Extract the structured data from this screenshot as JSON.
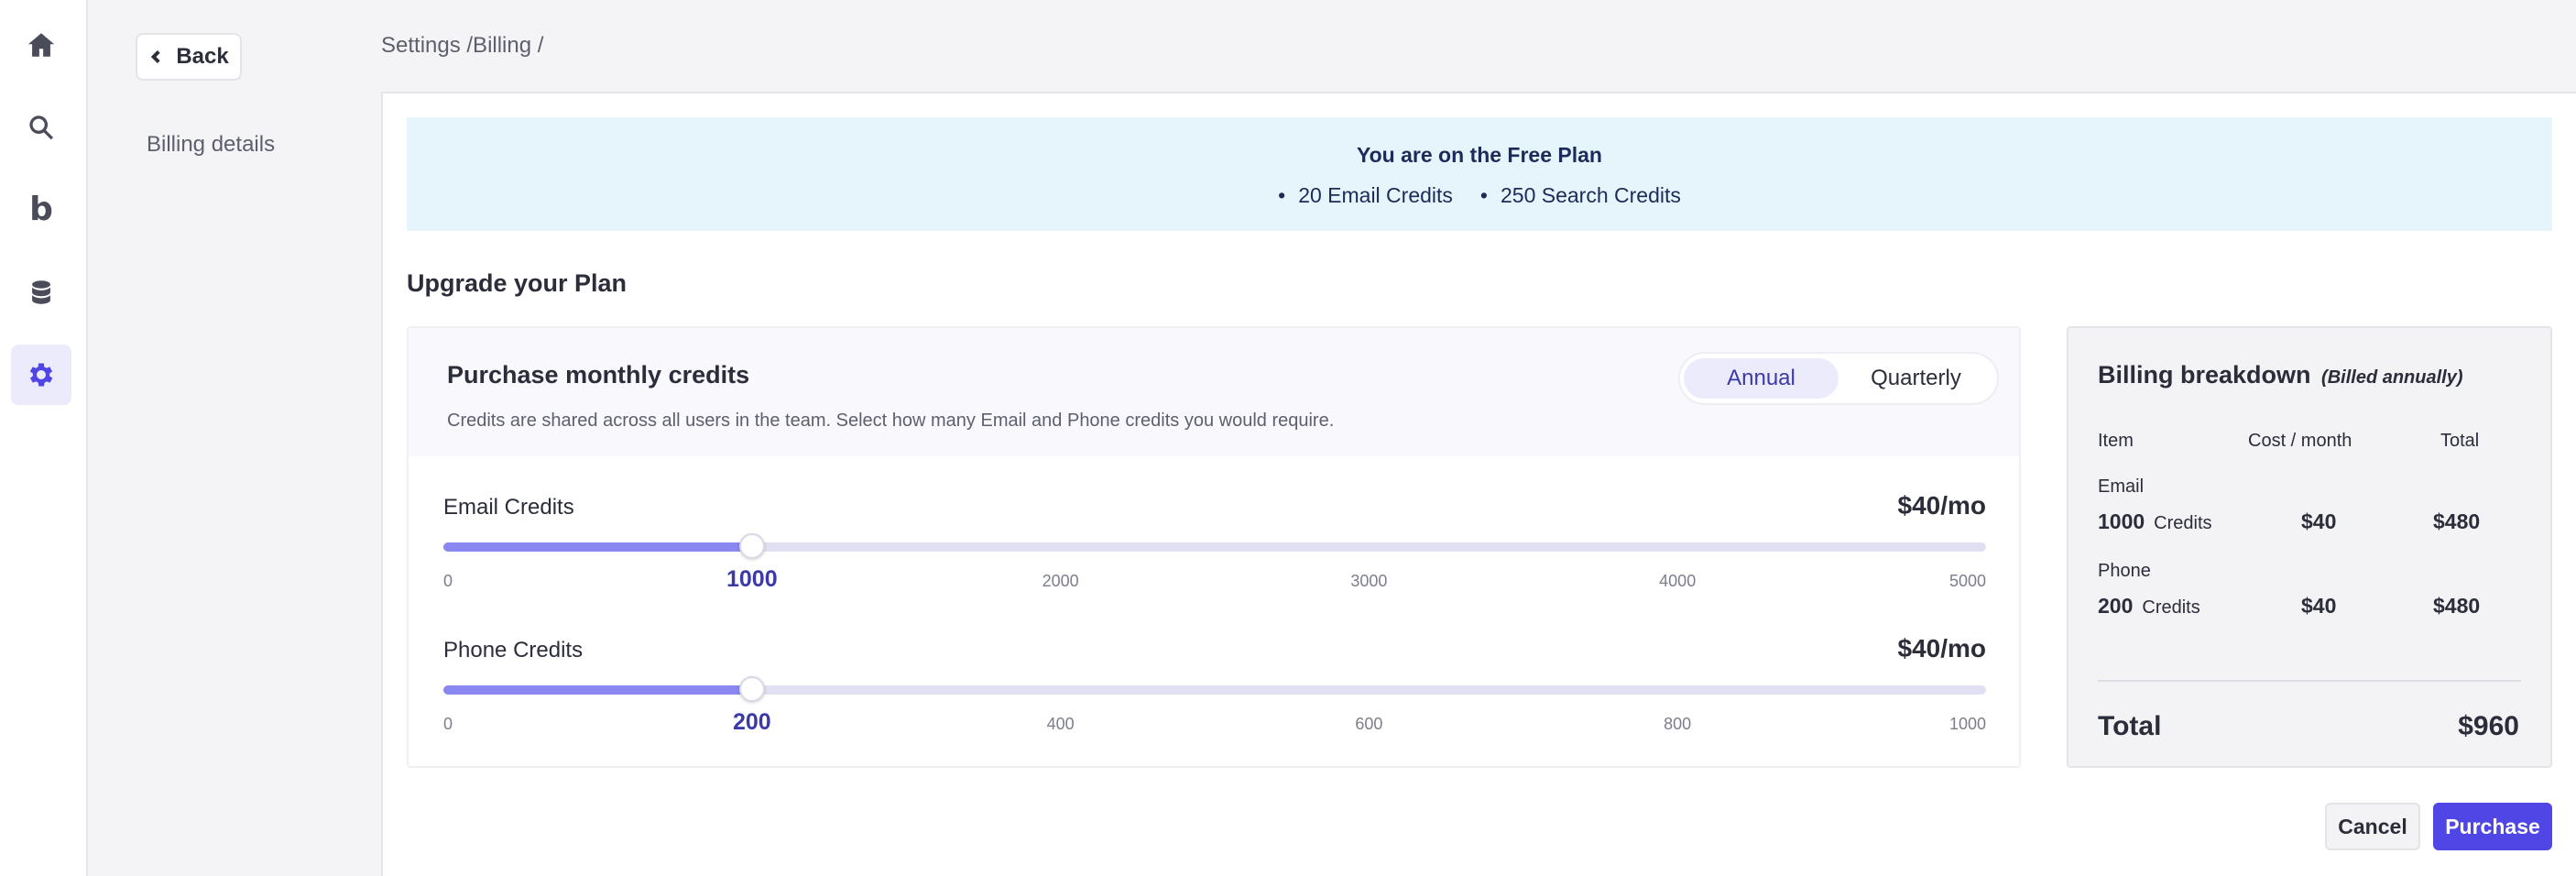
{
  "rail": {
    "items": [
      {
        "name": "home-icon"
      },
      {
        "name": "search-icon"
      },
      {
        "name": "brand-b-icon",
        "glyph": "b"
      },
      {
        "name": "database-icon"
      },
      {
        "name": "gear-icon",
        "active": true
      }
    ]
  },
  "subnav": {
    "back_label": "Back",
    "items": [
      {
        "label": "Billing details"
      }
    ]
  },
  "breadcrumb": "Settings /Billing /",
  "banner": {
    "title": "You are on the Free Plan",
    "items": [
      "20 Email Credits",
      "250 Search Credits"
    ]
  },
  "upgrade_title": "Upgrade your Plan",
  "credits": {
    "title": "Purchase monthly credits",
    "subtitle": "Credits are shared across all users in the team. Select how many Email and Phone credits you would require.",
    "toggle": {
      "options": [
        "Annual",
        "Quarterly"
      ],
      "selected": "Annual"
    },
    "email": {
      "label": "Email Credits",
      "price": "$40/mo",
      "min": 0,
      "max": 5000,
      "value": 1000,
      "ticks": [
        "0",
        "1000",
        "2000",
        "3000",
        "4000",
        "5000"
      ]
    },
    "phone": {
      "label": "Phone Credits",
      "price": "$40/mo",
      "min": 0,
      "max": 1000,
      "value": 200,
      "ticks": [
        "0",
        "200",
        "400",
        "600",
        "800",
        "1000"
      ]
    }
  },
  "breakdown": {
    "title": "Billing breakdown",
    "note": "(Billed annually)",
    "columns": [
      "Item",
      "Cost / month",
      "Total"
    ],
    "rows": [
      {
        "item": "Email",
        "qty": "1000",
        "unit": "Credits",
        "cost": "$40",
        "total": "$480"
      },
      {
        "item": "Phone",
        "qty": "200",
        "unit": "Credits",
        "cost": "$40",
        "total": "$480"
      }
    ],
    "total_label": "Total",
    "total_value": "$960"
  },
  "actions": {
    "cancel": "Cancel",
    "purchase": "Purchase"
  },
  "colors": {
    "accent": "#4f46e5",
    "slider_fill": "#8a88f0",
    "banner_bg": "#e6f5fc"
  }
}
